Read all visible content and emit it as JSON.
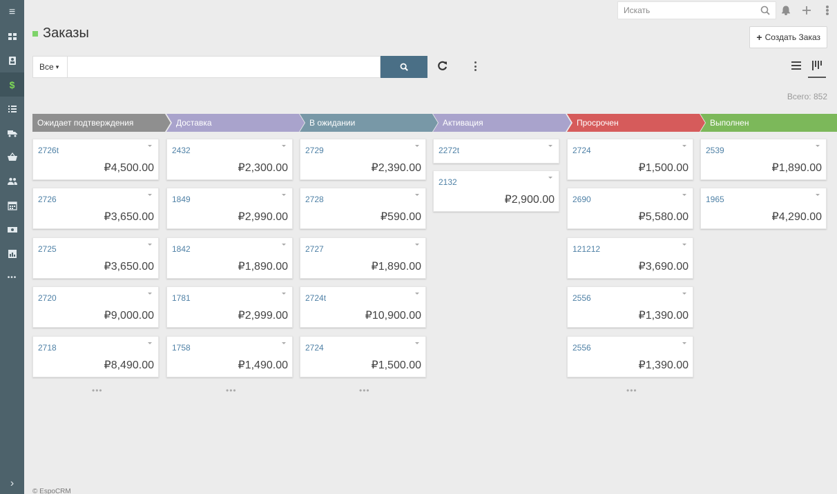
{
  "leftbar": {
    "items": [
      {
        "icon": "menu-icon",
        "glyph": "≡"
      },
      {
        "icon": "dashboard-icon",
        "glyph": ""
      },
      {
        "icon": "contacts-icon",
        "glyph": ""
      },
      {
        "icon": "dollar-icon",
        "glyph": "$",
        "active": true
      },
      {
        "icon": "list-icon",
        "glyph": ""
      },
      {
        "icon": "truck-icon",
        "glyph": ""
      },
      {
        "icon": "basket-icon",
        "glyph": ""
      },
      {
        "icon": "users-icon",
        "glyph": ""
      },
      {
        "icon": "calendar-icon",
        "glyph": ""
      },
      {
        "icon": "money-icon",
        "glyph": ""
      },
      {
        "icon": "chart-icon",
        "glyph": ""
      },
      {
        "icon": "more-icon",
        "glyph": "•••"
      }
    ],
    "collapse_glyph": "›"
  },
  "topbar": {
    "search_placeholder": "Искать"
  },
  "header": {
    "title": "Заказы",
    "create_label": "Создать Заказ",
    "create_plus": "+"
  },
  "filter": {
    "select_label": "Все",
    "select_caret": "▾",
    "search_value": ""
  },
  "total": "Всего: 852",
  "stages": [
    {
      "label": "Ожидает подтверждения",
      "color": "#8f8f8f"
    },
    {
      "label": "Доставка",
      "color": "#a9a3cc"
    },
    {
      "label": "В ожидании",
      "color": "#7898a7"
    },
    {
      "label": "Активация",
      "color": "#a9a3cc"
    },
    {
      "label": "Просрочен",
      "color": "#d65b5b"
    },
    {
      "label": "Выполнен",
      "color": "#7cb85a"
    }
  ],
  "columns": [
    {
      "cards": [
        {
          "num": "2726t",
          "price": "₽4,500.00"
        },
        {
          "num": "2726",
          "price": "₽3,650.00"
        },
        {
          "num": "2725",
          "price": "₽3,650.00"
        },
        {
          "num": "2720",
          "price": "₽9,000.00"
        },
        {
          "num": "2718",
          "price": "₽8,490.00"
        }
      ],
      "more": "•••"
    },
    {
      "cards": [
        {
          "num": "2432",
          "price": "₽2,300.00"
        },
        {
          "num": "1849",
          "price": "₽2,990.00"
        },
        {
          "num": "1842",
          "price": "₽1,890.00"
        },
        {
          "num": "1781",
          "price": "₽2,999.00"
        },
        {
          "num": "1758",
          "price": "₽1,490.00"
        }
      ],
      "more": "•••"
    },
    {
      "cards": [
        {
          "num": "2729",
          "price": "₽2,390.00"
        },
        {
          "num": "2728",
          "price": "₽590.00"
        },
        {
          "num": "2727",
          "price": "₽1,890.00"
        },
        {
          "num": "2724t",
          "price": "₽10,900.00"
        },
        {
          "num": "2724",
          "price": "₽1,500.00"
        }
      ],
      "more": "•••"
    },
    {
      "cards": [
        {
          "num": "2272t",
          "price": ""
        },
        {
          "num": "2132",
          "price": "₽2,900.00"
        }
      ],
      "more": ""
    },
    {
      "cards": [
        {
          "num": "2724",
          "price": "₽1,500.00"
        },
        {
          "num": "2690",
          "price": "₽5,580.00"
        },
        {
          "num": "121212",
          "price": "₽3,690.00"
        },
        {
          "num": "2556",
          "price": "₽1,390.00"
        },
        {
          "num": "2556",
          "price": "₽1,390.00"
        }
      ],
      "more": "•••"
    },
    {
      "cards": [
        {
          "num": "2539",
          "price": "₽1,890.00"
        },
        {
          "num": "1965",
          "price": "₽4,290.00"
        }
      ],
      "more": ""
    }
  ],
  "footer": "© EspoCRM"
}
